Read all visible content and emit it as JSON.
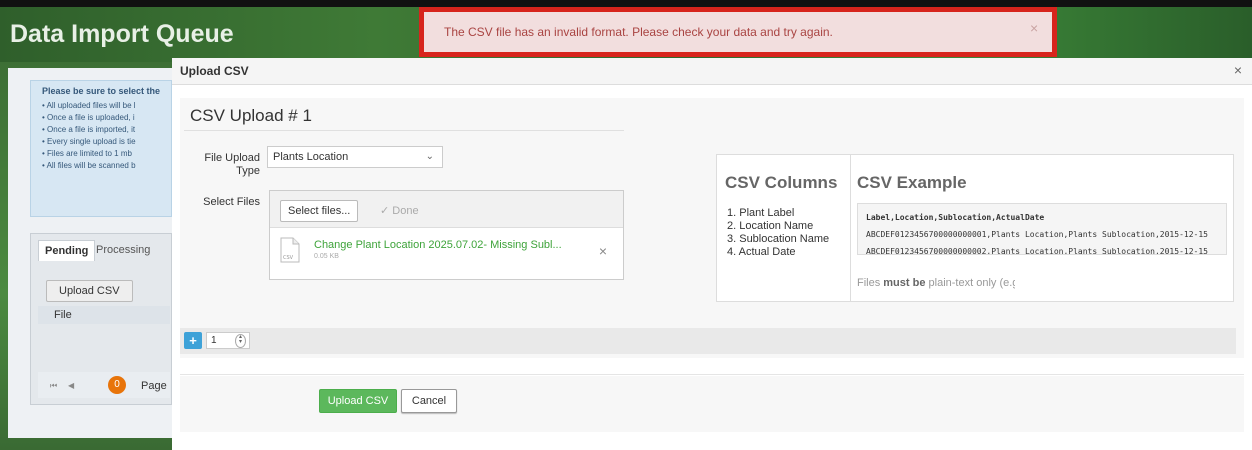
{
  "background": {
    "page_title": "Data Import Queue",
    "info_title": "Please be sure to select the",
    "info_items": [
      "All uploaded files will be l",
      "Once a file is uploaded, i",
      "Once a file is imported, it",
      "Every single upload is tie",
      "Files are limited to 1 mb",
      "All files will be scanned b"
    ],
    "tabs": [
      "Pending",
      "Processing"
    ],
    "upload_button": "Upload CSV",
    "file_column": "File",
    "pager_count": "0",
    "pager_label": "Page"
  },
  "alert": {
    "message": "The CSV file has an invalid format. Please check your data and try again.",
    "close": "×"
  },
  "modal": {
    "title": "Upload CSV",
    "close": "×",
    "upload_heading": "CSV Upload # 1",
    "file_upload_type_label": "File Upload Type",
    "file_upload_type_value": "Plants Location",
    "select_files_label": "Select Files",
    "select_files_button": "Select files...",
    "done_status": "✓ Done",
    "file": {
      "name": "Change Plant Location 2025.07.02- Missing Subl...",
      "size": "0.05 KB",
      "icon_tag": "CSV",
      "remove": "×"
    },
    "csv_columns_title": "CSV Columns",
    "csv_columns": [
      "1. Plant Label",
      "2. Location Name",
      "3. Sublocation Name",
      "4. Actual Date"
    ],
    "csv_example_title": "CSV Example",
    "csv_example_lines": [
      "Label,Location,Sublocation,ActualDate",
      "ABCDEF0123456700000000001,Plants Location,Plants Sublocation,2015-12-15",
      "ABCDEF0123456700000000002,Plants Location,Plants Sublocation,2015-12-15"
    ],
    "note_prefix": "Files ",
    "note_bold": "must be",
    "note_suffix": " plain-text only (e.g. CSV a",
    "add_button": "+",
    "count_value": "1",
    "upload_button": "Upload CSV",
    "cancel_button": "Cancel"
  },
  "colors": {
    "primary_green": "#5cb85c",
    "alert_border": "#d7241c",
    "alert_text": "#a94442",
    "add_blue": "#3ea2d8",
    "file_name_green": "#3ea33a"
  }
}
